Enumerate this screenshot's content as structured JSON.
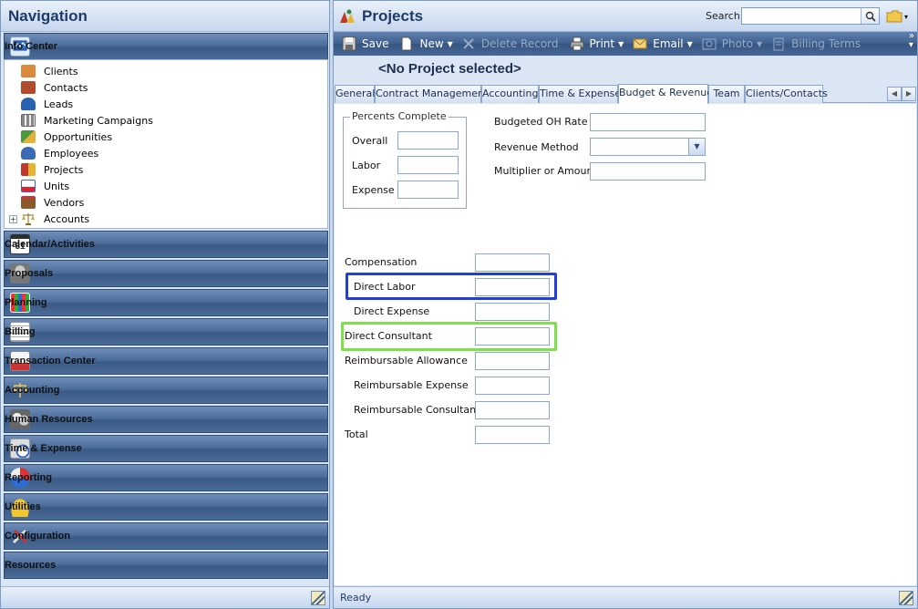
{
  "navigation": {
    "title": "Navigation",
    "info_center": {
      "label": "Info Center",
      "items": [
        {
          "label": "Clients",
          "icon": "clients-icon",
          "color": "#c9772f"
        },
        {
          "label": "Contacts",
          "icon": "contacts-icon",
          "color": "#b24b2c"
        },
        {
          "label": "Leads",
          "icon": "leads-icon",
          "color": "#2a62b3"
        },
        {
          "label": "Marketing Campaigns",
          "icon": "marketing-campaigns-icon",
          "color": "#7a7a7a"
        },
        {
          "label": "Opportunities",
          "icon": "opportunities-icon",
          "color": "#4a9a3b"
        },
        {
          "label": "Employees",
          "icon": "employees-icon",
          "color": "#3b6bb5"
        },
        {
          "label": "Projects",
          "icon": "projects-icon",
          "color": "#c0392b"
        },
        {
          "label": "Units",
          "icon": "units-icon",
          "color": "#3f67c9"
        },
        {
          "label": "Vendors",
          "icon": "vendors-icon",
          "color": "#8a5a2b"
        },
        {
          "label": "Accounts",
          "icon": "accounts-icon",
          "color": "#b08a2e",
          "expandable": true
        }
      ]
    },
    "sections": [
      {
        "label": "Calendar/Activities",
        "icon": "calendar-icon",
        "icon_text": "31"
      },
      {
        "label": "Proposals",
        "icon": "proposals-icon"
      },
      {
        "label": "Planning",
        "icon": "planning-icon"
      },
      {
        "label": "Billing",
        "icon": "billing-icon"
      },
      {
        "label": "Transaction Center",
        "icon": "transaction-center-icon"
      },
      {
        "label": "Accounting",
        "icon": "accounting-icon"
      },
      {
        "label": "Human Resources",
        "icon": "human-resources-icon"
      },
      {
        "label": "Time & Expense",
        "icon": "time-expense-icon"
      },
      {
        "label": "Reporting",
        "icon": "reporting-icon"
      },
      {
        "label": "Utilities",
        "icon": "utilities-icon"
      },
      {
        "label": "Configuration",
        "icon": "configuration-icon"
      },
      {
        "label": "Resources",
        "icon": "resources-icon"
      }
    ]
  },
  "main": {
    "title": "Projects",
    "search_label": "Search",
    "search_value": "",
    "toolbar": {
      "save": "Save",
      "new": "New",
      "delete": "Delete Record",
      "print": "Print",
      "email": "Email",
      "photo": "Photo",
      "billing_terms": "Billing Terms"
    },
    "record_title": "<No Project selected>",
    "tabs": [
      {
        "label": "General",
        "active": false
      },
      {
        "label": "Contract Management",
        "active": false
      },
      {
        "label": "Accounting",
        "active": false
      },
      {
        "label": "Time & Expense",
        "active": false
      },
      {
        "label": "Budget & Revenue",
        "active": true
      },
      {
        "label": "Team",
        "active": false
      },
      {
        "label": "Clients/Contacts",
        "active": false
      }
    ],
    "form": {
      "percents_complete": {
        "legend": "Percents Complete",
        "overall": {
          "label": "Overall",
          "value": ""
        },
        "labor": {
          "label": "Labor",
          "value": ""
        },
        "expense": {
          "label": "Expense",
          "value": ""
        }
      },
      "budgeted_oh_rate": {
        "label": "Budgeted OH Rate",
        "value": ""
      },
      "revenue_method": {
        "label": "Revenue Method",
        "value": ""
      },
      "multiplier": {
        "label": "Multiplier or Amount",
        "value": ""
      },
      "compensation": {
        "label": "Compensation",
        "value": ""
      },
      "direct_labor": {
        "label": "Direct Labor",
        "value": ""
      },
      "direct_expense": {
        "label": "Direct Expense",
        "value": ""
      },
      "direct_consultant": {
        "label": "Direct Consultant",
        "value": ""
      },
      "reimbursable_allowance": {
        "label": "Reimbursable Allowance",
        "value": ""
      },
      "reimbursable_expense": {
        "label": "Reimbursable Expense",
        "value": ""
      },
      "reimbursable_consultant": {
        "label": "Reimbursable Consultant",
        "value": ""
      },
      "total": {
        "label": "Total",
        "value": ""
      }
    },
    "status": "Ready"
  },
  "colors": {
    "nav_bar": "#4d6e9b",
    "highlight_blue": "#1f3fd8",
    "highlight_green": "#7ee04a"
  }
}
